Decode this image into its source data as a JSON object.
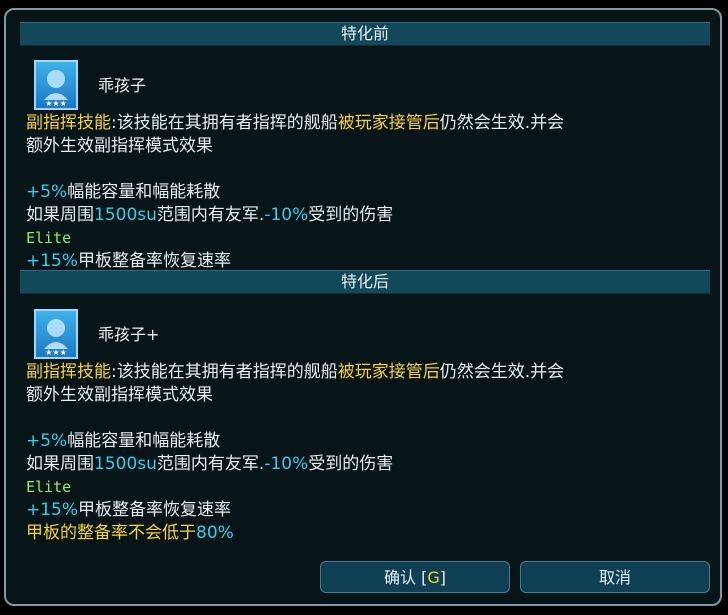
{
  "headers": {
    "before": "特化前",
    "after": "特化后"
  },
  "before": {
    "name": "乖孩子",
    "desc_label": "副指挥技能",
    "desc_p1": ":该技能在其拥有者指挥的舰船",
    "desc_highlight": "被玩家接管后",
    "desc_p2": "仍然会生效.并会",
    "desc_line2": "额外生效副指挥模式效果",
    "b1_val": "+5%",
    "b1_text": "幅能容量和幅能耗散",
    "b2_a": "如果周围",
    "b2_range": "1500su",
    "b2_b": "范围内有友军.",
    "b2_val": "-10%",
    "b2_c": "受到的伤害",
    "elite": "Elite",
    "b3_val": "+15%",
    "b3_text": "甲板整备率恢复速率"
  },
  "after": {
    "name": "乖孩子+",
    "desc_label": "副指挥技能",
    "desc_p1": ":该技能在其拥有者指挥的舰船",
    "desc_highlight": "被玩家接管后",
    "desc_p2": "仍然会生效.并会",
    "desc_line2": "额外生效副指挥模式效果",
    "b1_val": "+5%",
    "b1_text": "幅能容量和幅能耗散",
    "b2_a": "如果周围",
    "b2_range": "1500su",
    "b2_b": "范围内有友军.",
    "b2_val": "-10%",
    "b2_c": "受到的伤害",
    "elite": "Elite",
    "b3_val": "+15%",
    "b3_text": "甲板整备率恢复速率",
    "b4_text": "甲板的整备率不会低于",
    "b4_val": "80%"
  },
  "buttons": {
    "confirm_label": "确认 [",
    "confirm_key": "G",
    "confirm_close": "]",
    "cancel_label": "取消"
  },
  "colors": {
    "highlight_yellow": "#f7d234",
    "value_cyan": "#30d0ee",
    "elite_green": "#8ef05f",
    "header_bg": "#11485a"
  },
  "icons": {
    "portrait": "officer-portrait-icon"
  }
}
